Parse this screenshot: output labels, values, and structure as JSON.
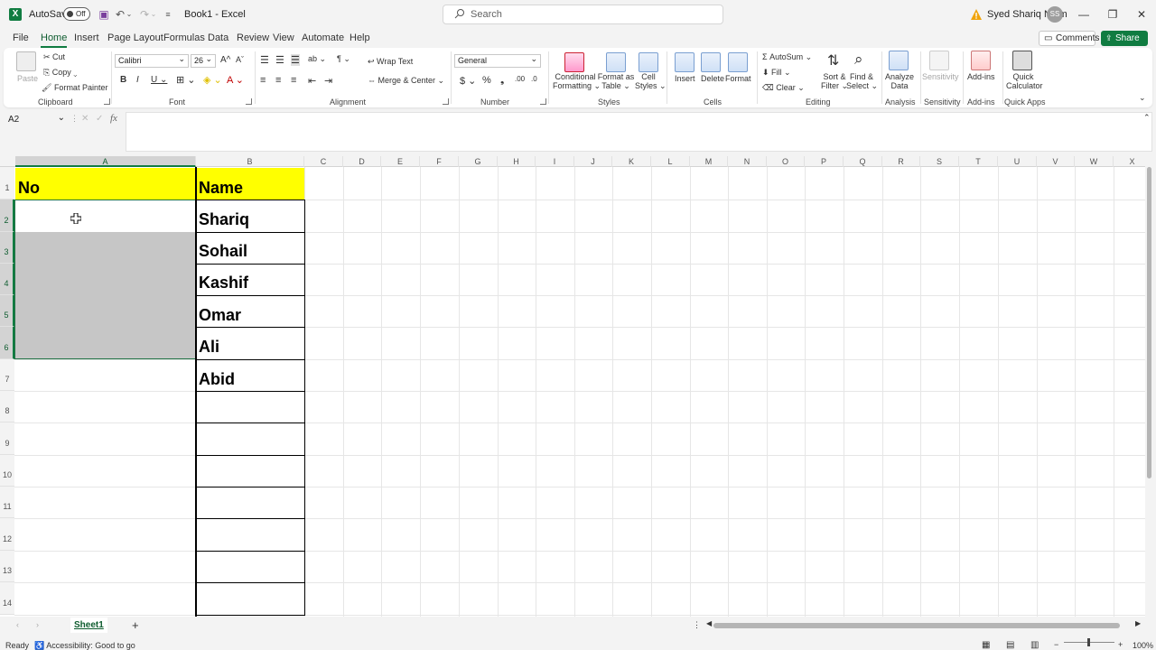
{
  "titlebar": {
    "autosave_label": "AutoSave",
    "autosave_state": "Off",
    "doc_title": "Book1  -  Excel",
    "search_placeholder": "Search",
    "user_name": "Syed Shariq Naim",
    "avatar_initials": "SS"
  },
  "tabs": [
    "File",
    "Home",
    "Insert",
    "Page Layout",
    "Formulas",
    "Data",
    "Review",
    "View",
    "Automate",
    "Help"
  ],
  "active_tab": "Home",
  "buttons": {
    "comments": "Comments",
    "share": "Share"
  },
  "ribbon": {
    "clipboard": {
      "paste": "Paste",
      "cut": "Cut",
      "copy": "Copy",
      "format_painter": "Format Painter",
      "label": "Clipboard"
    },
    "font": {
      "name": "Calibri",
      "size": "26",
      "label": "Font"
    },
    "alignment": {
      "wrap": "Wrap Text",
      "merge": "Merge & Center",
      "label": "Alignment"
    },
    "number": {
      "format": "General",
      "label": "Number"
    },
    "styles": {
      "conditional1": "Conditional",
      "conditional2": "Formatting",
      "table1": "Format as",
      "table2": "Table",
      "cell1": "Cell",
      "cell2": "Styles",
      "label": "Styles"
    },
    "cells": {
      "insert": "Insert",
      "delete": "Delete",
      "format": "Format",
      "label": "Cells"
    },
    "editing": {
      "autosum": "AutoSum",
      "fill": "Fill",
      "clear": "Clear",
      "sort1": "Sort &",
      "sort2": "Filter",
      "find1": "Find &",
      "find2": "Select",
      "label": "Editing"
    },
    "analysis": {
      "b1": "Analyze",
      "b2": "Data",
      "label": "Analysis"
    },
    "sensitivity": {
      "b1": "Sensitivity",
      "label": "Sensitivity"
    },
    "addins": {
      "b1": "Add-ins",
      "label": "Add-ins"
    },
    "quickapps": {
      "b1": "Quick",
      "b2": "Calculator",
      "label": "Quick Apps"
    }
  },
  "formula_bar": {
    "name_box": "A2",
    "fx": "fx",
    "content": ""
  },
  "columns": [
    "A",
    "B",
    "C",
    "D",
    "E",
    "F",
    "G",
    "H",
    "I",
    "J",
    "K",
    "L",
    "M",
    "N",
    "O",
    "P",
    "Q",
    "R",
    "S",
    "T",
    "U",
    "V",
    "W",
    "X"
  ],
  "rows": [
    "1",
    "2",
    "3",
    "4",
    "5",
    "6",
    "7",
    "8",
    "9",
    "10",
    "11",
    "12",
    "13",
    "14"
  ],
  "cells": {
    "a1": "No",
    "b1": "Name",
    "b2": "Shariq",
    "b3": "Sohail",
    "b4": "Kashif",
    "b5": "Omar",
    "b6": "Ali",
    "b7": "Abid"
  },
  "sheet": {
    "name": "Sheet1"
  },
  "status": {
    "ready": "Ready",
    "accessibility": "Accessibility: Good to go",
    "zoom": "100%"
  },
  "colors": {
    "accent": "#107c41",
    "highlight": "#ffff00",
    "selection_shade": "#c6c6c6"
  }
}
